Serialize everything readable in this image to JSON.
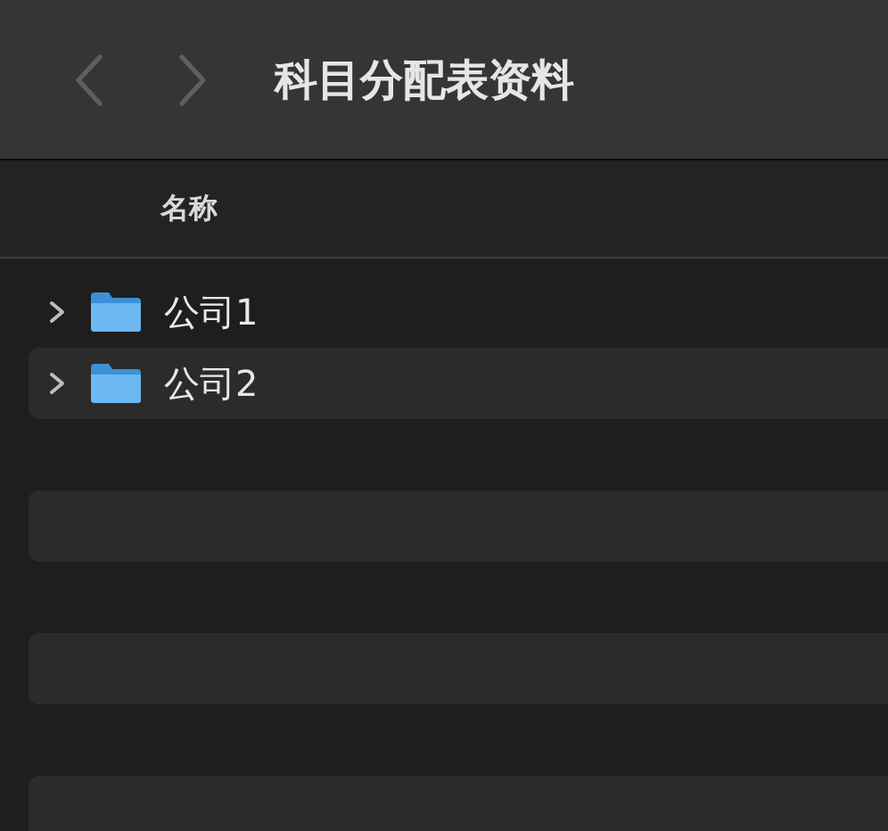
{
  "toolbar": {
    "title": "科目分配表资料",
    "back": {
      "disabled": true
    },
    "forward": {
      "disabled": true
    }
  },
  "columns": [
    {
      "label": "名称"
    }
  ],
  "rows": [
    {
      "name": "公司1",
      "expanded": false
    },
    {
      "name": "公司2",
      "expanded": false
    }
  ]
}
